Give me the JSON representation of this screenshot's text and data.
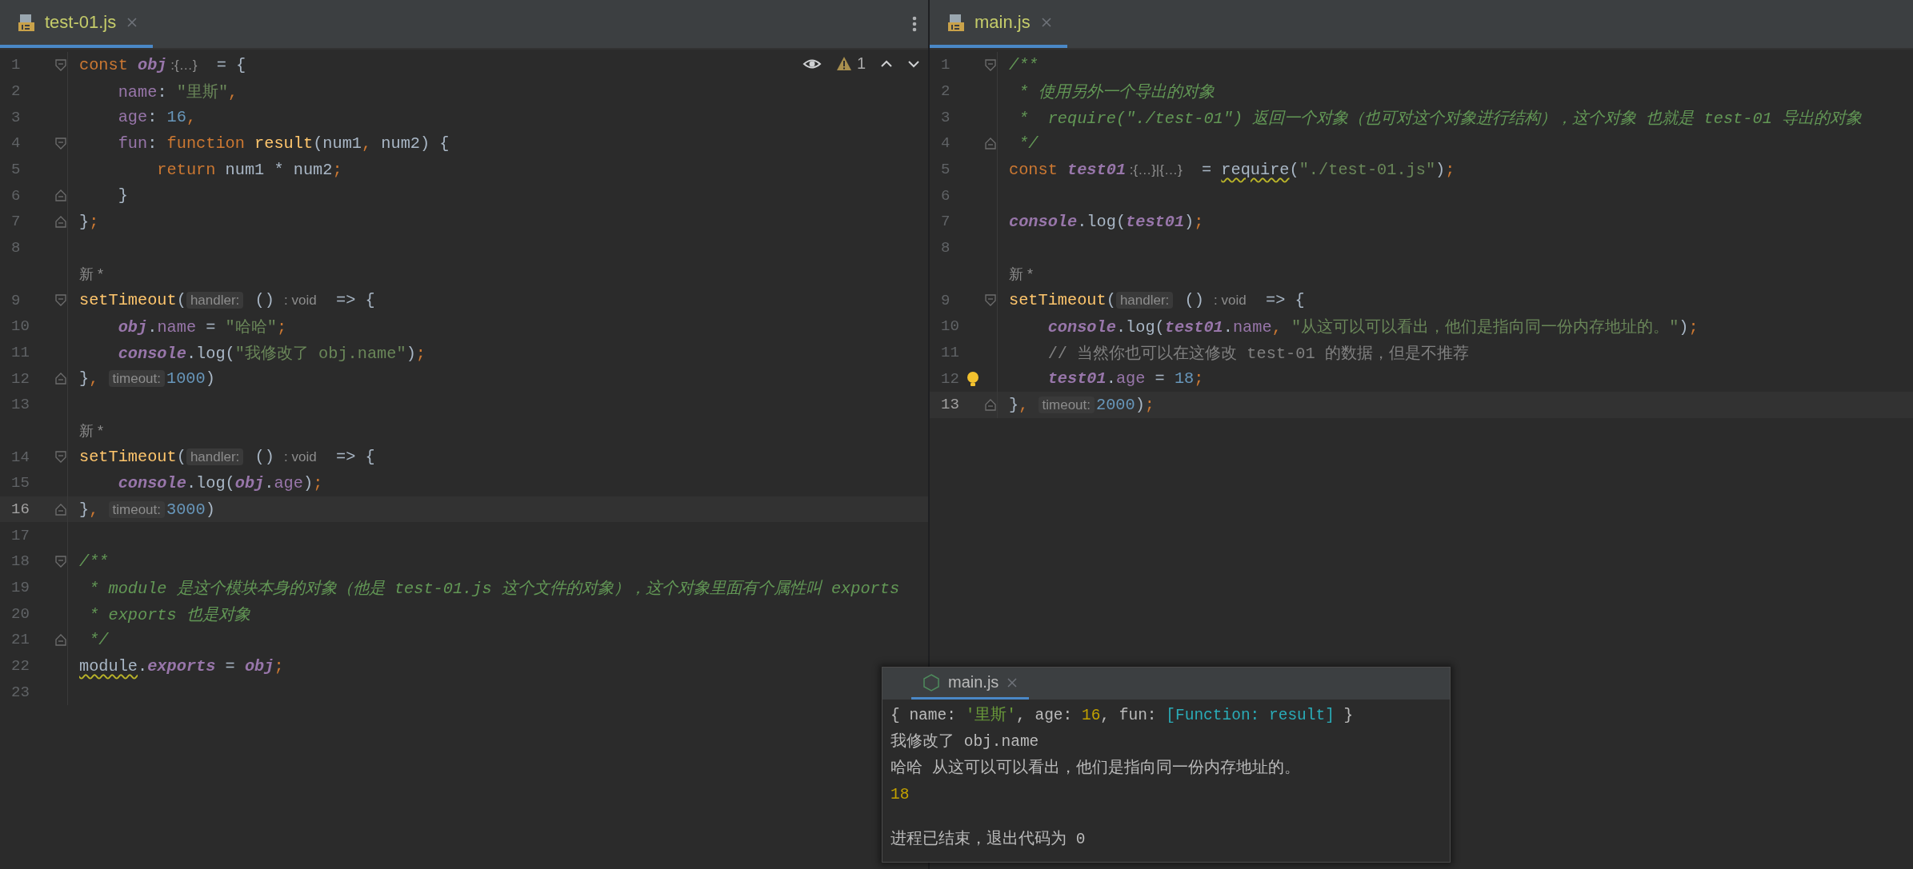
{
  "editors": [
    {
      "tab": {
        "label": "test-01.js",
        "selected": true
      },
      "toolbar": {
        "warning_count": "1"
      },
      "lines": [
        {
          "number": "1",
          "fold_open": true,
          "tokens": [
            {
              "kind": "keyword",
              "text": "const "
            },
            {
              "kind": "variable",
              "text": "obj"
            },
            {
              "kind": "type",
              "text": " :{…}"
            },
            {
              "kind": "plain",
              "text": "  = {"
            }
          ]
        },
        {
          "number": "2",
          "tokens": [
            {
              "kind": "property",
              "text": "    name"
            },
            {
              "kind": "plain",
              "text": ": "
            },
            {
              "kind": "string",
              "text": "\"里斯\""
            },
            {
              "kind": "punct",
              "text": ","
            }
          ]
        },
        {
          "number": "3",
          "tokens": [
            {
              "kind": "property",
              "text": "    age"
            },
            {
              "kind": "plain",
              "text": ": "
            },
            {
              "kind": "number",
              "text": "16"
            },
            {
              "kind": "punct",
              "text": ","
            }
          ]
        },
        {
          "number": "4",
          "fold_open": true,
          "tokens": [
            {
              "kind": "property",
              "text": "    fun"
            },
            {
              "kind": "plain",
              "text": ": "
            },
            {
              "kind": "keyword",
              "text": "function "
            },
            {
              "kind": "function",
              "text": "result"
            },
            {
              "kind": "plain",
              "text": "(num1"
            },
            {
              "kind": "punct",
              "text": ","
            },
            {
              "kind": "plain",
              "text": " num2) {"
            }
          ]
        },
        {
          "number": "5",
          "tokens": [
            {
              "kind": "keyword",
              "text": "        return "
            },
            {
              "kind": "plain",
              "text": "num1 * num2"
            },
            {
              "kind": "punct",
              "text": ";"
            }
          ]
        },
        {
          "number": "6",
          "fold_close": true,
          "tokens": [
            {
              "kind": "plain",
              "text": "    }"
            }
          ]
        },
        {
          "number": "7",
          "fold_close": true,
          "tokens": [
            {
              "kind": "plain",
              "text": "}"
            },
            {
              "kind": "punct",
              "text": ";"
            }
          ]
        },
        {
          "number": "8"
        },
        {
          "kind": "author",
          "text": "新 *"
        },
        {
          "number": "9",
          "fold_open": true,
          "tokens": [
            {
              "kind": "function",
              "text": "setTimeout"
            },
            {
              "kind": "plain",
              "text": "("
            },
            {
              "kind": "hint",
              "text": "handler:"
            },
            {
              "kind": "plain",
              "text": " () "
            },
            {
              "kind": "type",
              "text": ": void"
            },
            {
              "kind": "plain",
              "text": "  => {"
            }
          ]
        },
        {
          "number": "10",
          "tokens": [
            {
              "kind": "variable",
              "text": "    obj"
            },
            {
              "kind": "plain",
              "text": "."
            },
            {
              "kind": "property",
              "text": "name"
            },
            {
              "kind": "plain",
              "text": " = "
            },
            {
              "kind": "string",
              "text": "\"哈哈\""
            },
            {
              "kind": "punct",
              "text": ";"
            }
          ]
        },
        {
          "number": "11",
          "tokens": [
            {
              "kind": "variable",
              "text": "    console"
            },
            {
              "kind": "plain",
              "text": ".log("
            },
            {
              "kind": "string",
              "text": "\"我修改了 obj.name\""
            },
            {
              "kind": "plain",
              "text": ")"
            },
            {
              "kind": "punct",
              "text": ";"
            }
          ]
        },
        {
          "number": "12",
          "fold_close": true,
          "tokens": [
            {
              "kind": "plain",
              "text": "}"
            },
            {
              "kind": "punct",
              "text": ", "
            },
            {
              "kind": "hint",
              "text": "timeout:"
            },
            {
              "kind": "number",
              "text": "1000"
            },
            {
              "kind": "plain",
              "text": ")"
            }
          ]
        },
        {
          "number": "13"
        },
        {
          "kind": "author",
          "text": "新 *"
        },
        {
          "number": "14",
          "fold_open": true,
          "tokens": [
            {
              "kind": "function",
              "text": "setTimeout"
            },
            {
              "kind": "plain",
              "text": "("
            },
            {
              "kind": "hint",
              "text": "handler:"
            },
            {
              "kind": "plain",
              "text": " () "
            },
            {
              "kind": "type",
              "text": ": void"
            },
            {
              "kind": "plain",
              "text": "  => {"
            }
          ]
        },
        {
          "number": "15",
          "tokens": [
            {
              "kind": "variable",
              "text": "    console"
            },
            {
              "kind": "plain",
              "text": ".log("
            },
            {
              "kind": "variable",
              "text": "obj"
            },
            {
              "kind": "plain",
              "text": "."
            },
            {
              "kind": "property",
              "text": "age"
            },
            {
              "kind": "plain",
              "text": ")"
            },
            {
              "kind": "punct",
              "text": ";"
            }
          ]
        },
        {
          "number": "16",
          "fold_close": true,
          "current": true,
          "tokens": [
            {
              "kind": "plain",
              "text": "}"
            },
            {
              "kind": "punct",
              "text": ", "
            },
            {
              "kind": "hint",
              "text": "timeout:"
            },
            {
              "kind": "number",
              "text": "3000"
            },
            {
              "kind": "plain",
              "text": ")"
            }
          ]
        },
        {
          "number": "17"
        },
        {
          "number": "18",
          "fold_open": true,
          "tokens": [
            {
              "kind": "doc",
              "text": "/**"
            }
          ]
        },
        {
          "number": "19",
          "tokens": [
            {
              "kind": "doc",
              "text": " * module 是这个模块本身的对象（他是 test-01.js 这个文件的对象），这个对象里面有个属性叫 exports"
            }
          ]
        },
        {
          "number": "20",
          "tokens": [
            {
              "kind": "doc",
              "text": " * exports 也是对象"
            }
          ]
        },
        {
          "number": "21",
          "fold_close": true,
          "tokens": [
            {
              "kind": "doc",
              "text": " */"
            }
          ]
        },
        {
          "number": "22",
          "tokens": [
            {
              "kind": "warned",
              "text": "module"
            },
            {
              "kind": "plain",
              "text": "."
            },
            {
              "kind": "variable",
              "text": "exports"
            },
            {
              "kind": "plain",
              "text": " = "
            },
            {
              "kind": "variable",
              "text": "obj"
            },
            {
              "kind": "punct",
              "text": ";"
            }
          ]
        },
        {
          "number": "23"
        }
      ]
    },
    {
      "tab": {
        "label": "main.js",
        "selected": true
      },
      "lines": [
        {
          "number": "1",
          "fold_open": true,
          "tokens": [
            {
              "kind": "doc",
              "text": "/**"
            }
          ]
        },
        {
          "number": "2",
          "tokens": [
            {
              "kind": "doc",
              "text": " * 使用另外一个导出的对象"
            }
          ]
        },
        {
          "number": "3",
          "tokens": [
            {
              "kind": "doc",
              "text": " *  require(\"./test-01\") 返回一个对象（也可对这个对象进行结构），这个对象 也就是 test-01 导出的对象"
            }
          ]
        },
        {
          "number": "4",
          "fold_close": true,
          "tokens": [
            {
              "kind": "doc",
              "text": " */"
            }
          ]
        },
        {
          "number": "5",
          "tokens": [
            {
              "kind": "keyword",
              "text": "const "
            },
            {
              "kind": "variable",
              "text": "test01"
            },
            {
              "kind": "type",
              "text": " :{…}|{…}"
            },
            {
              "kind": "plain",
              "text": "  = "
            },
            {
              "kind": "warned",
              "text": "require"
            },
            {
              "kind": "plain",
              "text": "("
            },
            {
              "kind": "string",
              "text": "\"./test-01.js\""
            },
            {
              "kind": "plain",
              "text": ")"
            },
            {
              "kind": "punct",
              "text": ";"
            }
          ]
        },
        {
          "number": "6"
        },
        {
          "number": "7",
          "tokens": [
            {
              "kind": "variable",
              "text": "console"
            },
            {
              "kind": "plain",
              "text": ".log("
            },
            {
              "kind": "variable",
              "text": "test01"
            },
            {
              "kind": "plain",
              "text": ")"
            },
            {
              "kind": "punct",
              "text": ";"
            }
          ]
        },
        {
          "number": "8"
        },
        {
          "kind": "author",
          "text": "新 *"
        },
        {
          "number": "9",
          "fold_open": true,
          "tokens": [
            {
              "kind": "function",
              "text": "setTimeout"
            },
            {
              "kind": "plain",
              "text": "("
            },
            {
              "kind": "hint",
              "text": "handler:"
            },
            {
              "kind": "plain",
              "text": " () "
            },
            {
              "kind": "type",
              "text": ": void"
            },
            {
              "kind": "plain",
              "text": "  => {"
            }
          ]
        },
        {
          "number": "10",
          "tokens": [
            {
              "kind": "variable",
              "text": "    console"
            },
            {
              "kind": "plain",
              "text": ".log("
            },
            {
              "kind": "variable",
              "text": "test01"
            },
            {
              "kind": "plain",
              "text": "."
            },
            {
              "kind": "property",
              "text": "name"
            },
            {
              "kind": "punct",
              "text": ","
            },
            {
              "kind": "string",
              "text": " \"从这可以可以看出，他们是指向同一份内存地址的。\""
            },
            {
              "kind": "plain",
              "text": ")"
            },
            {
              "kind": "punct",
              "text": ";"
            }
          ]
        },
        {
          "number": "11",
          "tokens": [
            {
              "kind": "comment",
              "text": "    // 当然你也可以在这修改 test-01 的数据，但是不推荐"
            }
          ]
        },
        {
          "number": "12",
          "bulb": true,
          "tokens": [
            {
              "kind": "variable",
              "text": "    test01"
            },
            {
              "kind": "plain",
              "text": "."
            },
            {
              "kind": "property",
              "text": "age"
            },
            {
              "kind": "plain",
              "text": " = "
            },
            {
              "kind": "number",
              "text": "18"
            },
            {
              "kind": "punct",
              "text": ";"
            }
          ]
        },
        {
          "number": "13",
          "fold_close": true,
          "current": true,
          "tokens": [
            {
              "kind": "plain",
              "text": "}"
            },
            {
              "kind": "punct",
              "text": ", "
            },
            {
              "kind": "hint",
              "text": "timeout:"
            },
            {
              "kind": "number",
              "text": "2000"
            },
            {
              "kind": "plain",
              "text": ")"
            },
            {
              "kind": "punct",
              "text": ";"
            }
          ]
        }
      ]
    }
  ],
  "run_console": {
    "tab": {
      "label": "main.js",
      "selected": true
    },
    "output": [
      {
        "tokens": [
          {
            "kind": "text",
            "text": "{ name: "
          },
          {
            "kind": "string",
            "text": "'里斯'"
          },
          {
            "kind": "text",
            "text": ", age: "
          },
          {
            "kind": "number",
            "text": "16"
          },
          {
            "kind": "text",
            "text": ", fun: "
          },
          {
            "kind": "function",
            "text": "[Function: result]"
          },
          {
            "kind": "text",
            "text": " }"
          }
        ]
      },
      {
        "tokens": [
          {
            "kind": "text",
            "text": "我修改了 obj.name"
          }
        ]
      },
      {
        "tokens": [
          {
            "kind": "text",
            "text": "哈哈 从这可以可以看出，他们是指向同一份内存地址的。"
          }
        ]
      },
      {
        "tokens": [
          {
            "kind": "number",
            "text": "18"
          }
        ]
      },
      {
        "tokens": [
          {
            "kind": "text",
            "text": "进程已结束，退出代码为 0"
          }
        ]
      }
    ]
  }
}
